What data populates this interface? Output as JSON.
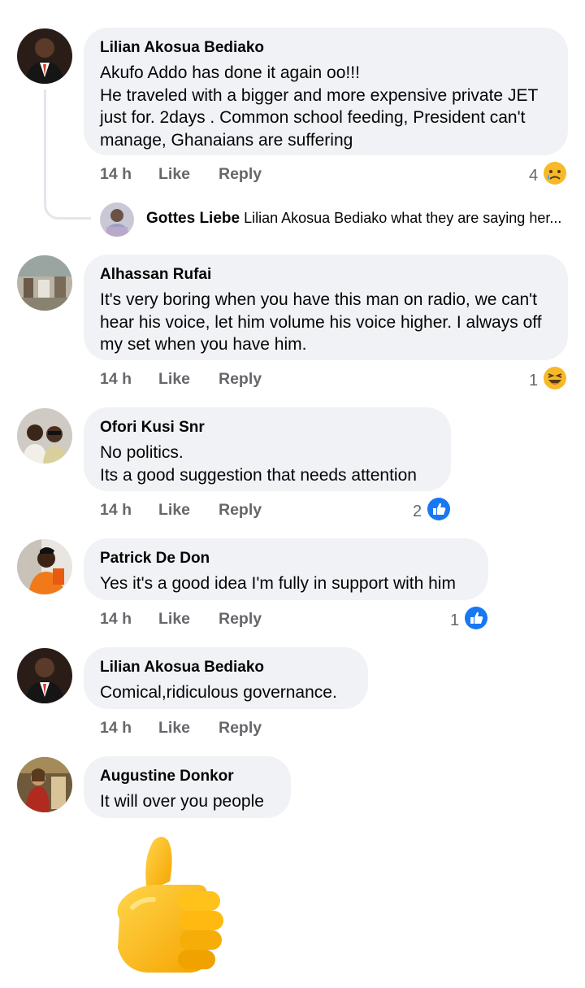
{
  "comments": [
    {
      "author": "Lilian Akosua Bediako",
      "text": "Akufo Addo has done it again oo!!!\nHe traveled with a bigger and more  expensive private JET just for. 2days . Common school feeding, President can't manage, Ghanaians are suffering",
      "time": "14 h",
      "like": "Like",
      "reply": "Reply",
      "reaction_count": "4",
      "reaction": "sad-emoji"
    },
    {
      "author": "Alhassan Rufai",
      "text": "It's very boring when you have this man on radio, we can't hear his voice, let him volume his  voice  higher. I always off my set when you have him.",
      "time": "14 h",
      "like": "Like",
      "reply": "Reply",
      "reaction_count": "1",
      "reaction": "laugh-emoji"
    },
    {
      "author": "Ofori Kusi Snr",
      "text": "No politics.\nIts a good suggestion that needs attention",
      "time": "14 h",
      "like": "Like",
      "reply": "Reply",
      "reaction_count": "2",
      "reaction": "like-icon"
    },
    {
      "author": "Patrick De Don",
      "text": "Yes it's a good idea I'm fully in support with him",
      "time": "14 h",
      "like": "Like",
      "reply": "Reply",
      "reaction_count": "1",
      "reaction": "like-icon"
    },
    {
      "author": "Lilian Akosua Bediako",
      "text": "Comical,ridiculous governance.",
      "time": "14 h",
      "like": "Like",
      "reply": "Reply"
    },
    {
      "author": "Augustine Donkor",
      "text": "It will over you people",
      "sticker": "thumbs-up-emoji"
    }
  ],
  "reply_preview": {
    "author": "Gottes Liebe",
    "text": "Lilian Akosua Bediako what they are saying her..."
  },
  "colors": {
    "bubble": "#f0f2f5",
    "meta": "#65676b",
    "like_blue": "#1877f2",
    "emoji_yellow": "#f7b928"
  }
}
